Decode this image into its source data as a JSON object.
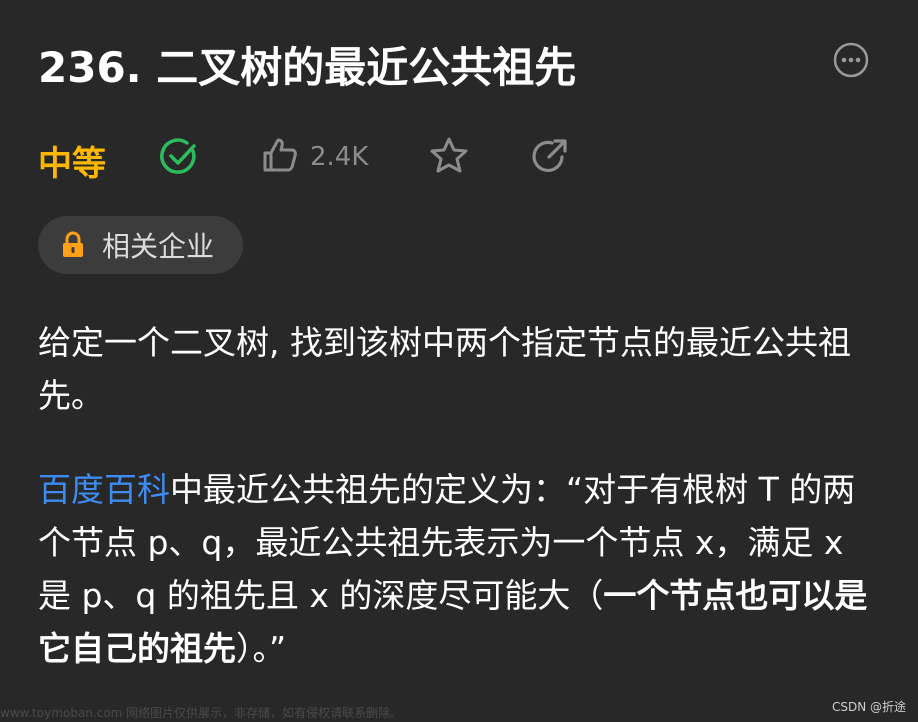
{
  "problem": {
    "title": "236. 二叉树的最近公共祖先",
    "difficulty": "中等",
    "likes": "2.4K",
    "company_tag": "相关企业"
  },
  "description": {
    "p1": "给定一个二叉树, 找到该树中两个指定节点的最近公共祖先。",
    "p2_link": "百度百科",
    "p2_text": "中最近公共祖先的定义为：“对于有根树 T 的两个节点 p、q，最近公共祖先表示为一个节点 x，满足 x 是 p、q 的祖先且 x 的深度尽可能大（",
    "p2_bold": "一个节点也可以是它自己的祖先",
    "p2_end": "）。”"
  },
  "watermark": {
    "left": "www.toymoban.com 网络图片仅供展示，非存储，如有侵权请联系删除。",
    "right": "CSDN @折途"
  },
  "colors": {
    "background": "#282828",
    "difficulty": "#ffb800",
    "solved": "#2cbb5d",
    "link": "#3e8cf2",
    "lock": "#ffa116"
  }
}
